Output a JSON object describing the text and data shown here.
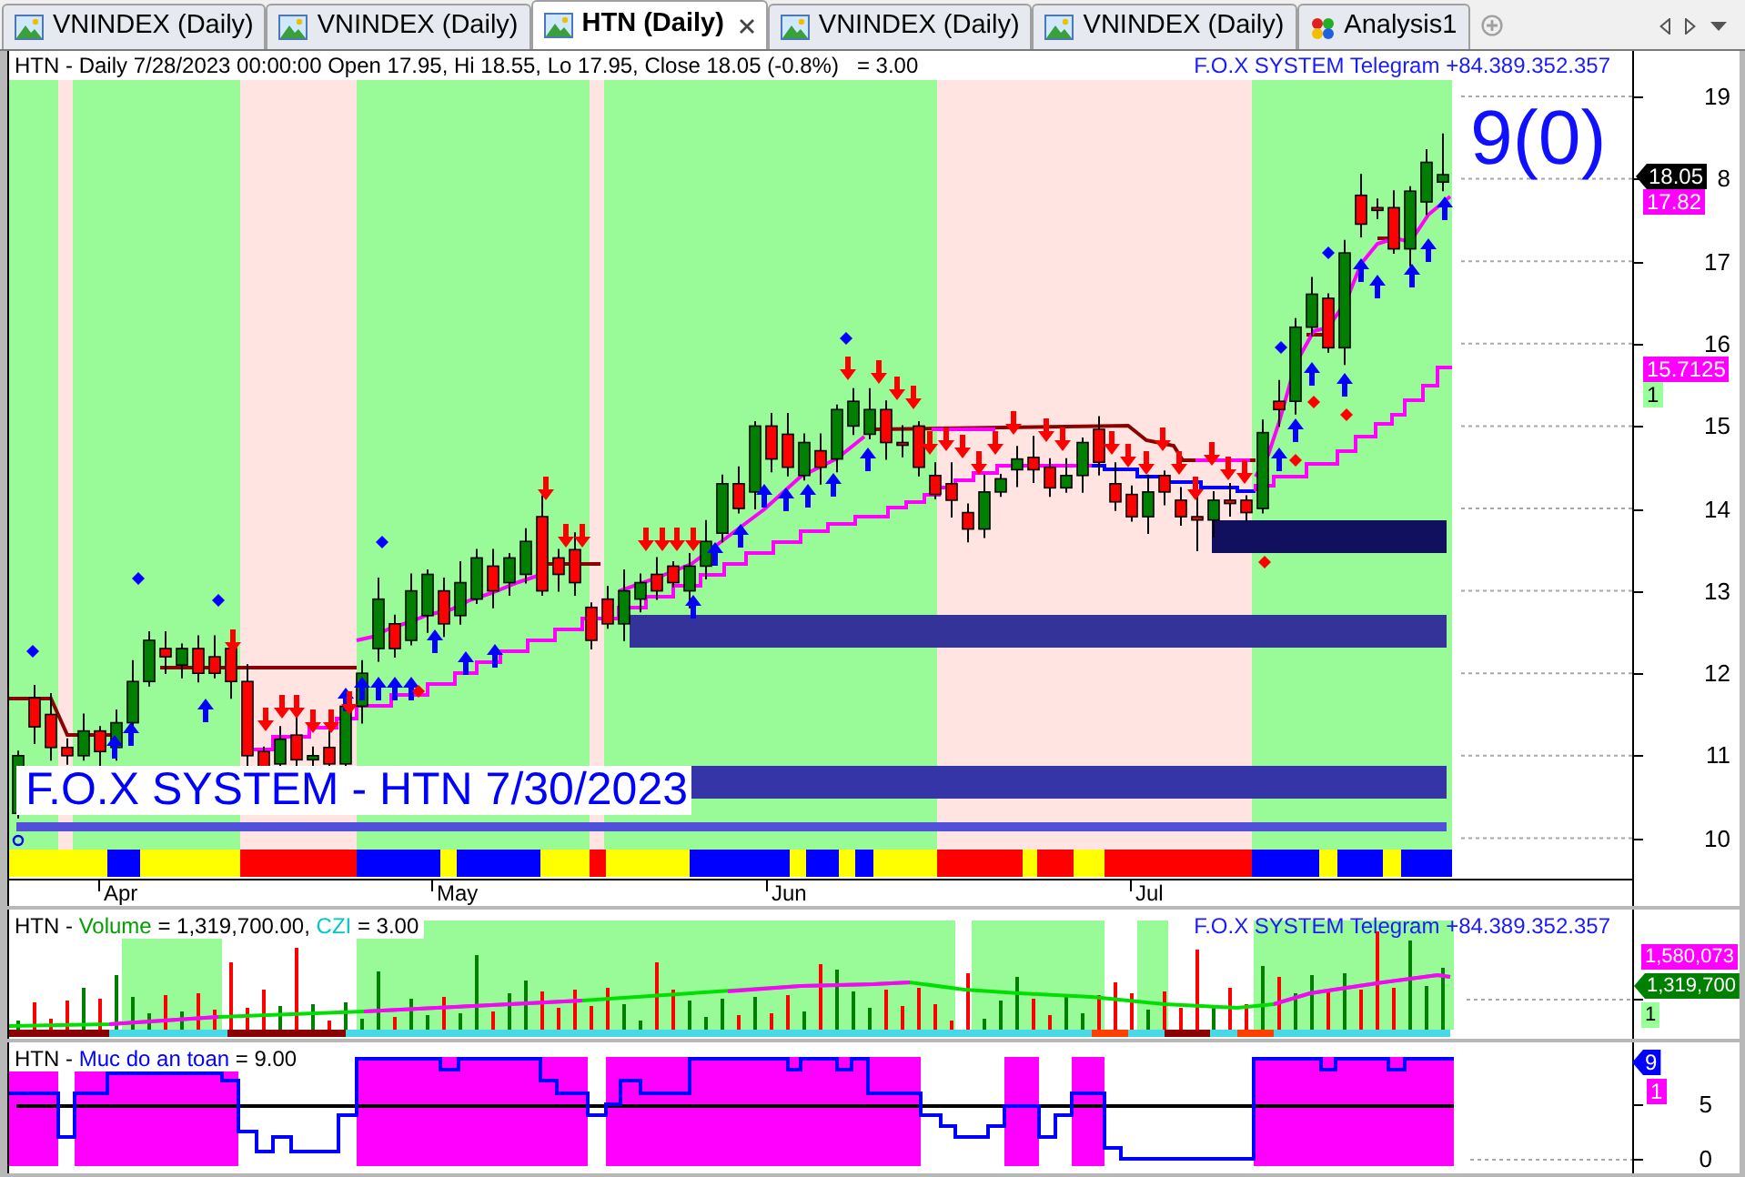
{
  "tabs": [
    {
      "label": "VNINDEX (Daily)",
      "selected": false,
      "kind": "chart"
    },
    {
      "label": "VNINDEX (Daily)",
      "selected": false,
      "kind": "chart"
    },
    {
      "label": "HTN (Daily)",
      "selected": true,
      "kind": "chart"
    },
    {
      "label": "VNINDEX (Daily)",
      "selected": false,
      "kind": "chart"
    },
    {
      "label": "VNINDEX (Daily)",
      "selected": false,
      "kind": "chart"
    },
    {
      "label": "Analysis1",
      "selected": false,
      "kind": "analysis"
    }
  ],
  "price_pane": {
    "header": "HTN - Daily 7/28/2023 00:00:00 Open 17.95, Hi 18.55, Lo 17.95, Close 18.05 (-0.8%)   = 3.00",
    "contact": "F.O.X SYSTEM Telegram +84.389.352.357",
    "signal_count": "9(0)",
    "chart_label": "F.O.X SYSTEM - HTN 7/30/2023",
    "y_axis_labels": [
      "19",
      "8",
      "17",
      "16",
      "15",
      "14",
      "13",
      "12",
      "11",
      "10"
    ],
    "x_axis_labels": [
      "Apr",
      "May",
      "Jun",
      "Jul"
    ],
    "tags": [
      {
        "text": "18.05",
        "color": "#000000",
        "kind": "pointer"
      },
      {
        "text": "17.82",
        "color": "#ff00ff",
        "kind": "plain"
      },
      {
        "text": "15.7125",
        "color": "#ff00ff",
        "kind": "plain"
      },
      {
        "text": "1",
        "color": "#99ff99",
        "kind": "plain"
      }
    ]
  },
  "volume_pane": {
    "header_parts": [
      {
        "text": "HTN - ",
        "color": "#000000"
      },
      {
        "text": "Volume",
        "color": "#00a000"
      },
      {
        "text": " = 1,319,700.00, ",
        "color": "#000000"
      },
      {
        "text": "CZI",
        "color": "#00c8c8"
      },
      {
        "text": " = 3.00",
        "color": "#000000"
      }
    ],
    "contact": "F.O.X SYSTEM Telegram +84.389.352.357",
    "tags": [
      {
        "text": "1,580,073",
        "color": "#ff00ff",
        "kind": "plain"
      },
      {
        "text": "1,319,700",
        "color": "#008000",
        "kind": "pointer"
      },
      {
        "text": "1",
        "color": "#99ff99",
        "kind": "plain"
      }
    ]
  },
  "indicator_pane": {
    "header_parts": [
      {
        "text": "HTN - ",
        "color": "#000000"
      },
      {
        "text": "Muc do an toan",
        "color": "#0000ff"
      },
      {
        "text": " = 9.00",
        "color": "#000000"
      }
    ],
    "y_axis_labels": [
      "5",
      "0"
    ],
    "tags": [
      {
        "text": "9",
        "color": "#0000ff",
        "kind": "pointer"
      },
      {
        "text": "1",
        "color": "#ff00ff",
        "kind": "plain"
      }
    ]
  }
}
